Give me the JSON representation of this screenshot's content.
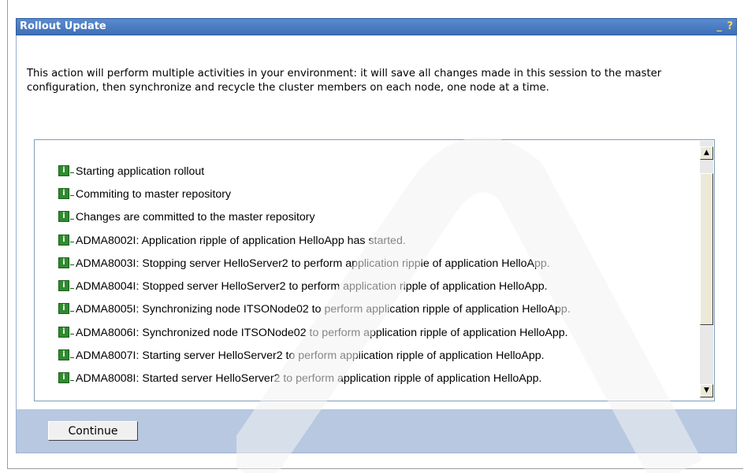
{
  "window": {
    "title": "Rollout Update",
    "controls": "_ ?"
  },
  "intro_text": "This action will perform multiple activities in your environment: it will save all changes made in this session to the master configuration, then synchronize and recycle the cluster members on each node, one node at a time.",
  "log": {
    "items": [
      "Starting application rollout",
      "Commiting to master repository",
      "Changes are committed to the master repository",
      "ADMA8002I: Application ripple of application HelloApp has started.",
      "ADMA8003I: Stopping server HelloServer2 to perform application ripple of application HelloApp.",
      "ADMA8004I: Stopped server HelloServer2 to perform application ripple of application HelloApp.",
      "ADMA8005I: Synchronizing node ITSONode02 to perform application ripple of application HelloApp.",
      "ADMA8006I: Synchronized node ITSONode02 to perform application ripple of application HelloApp.",
      "ADMA8007I: Starting server HelloServer2 to perform application ripple of application HelloApp.",
      "ADMA8008I: Started server HelloServer2 to perform application ripple of application HelloApp."
    ],
    "icon": "info-icon"
  },
  "buttons": {
    "continue": "Continue"
  },
  "colors": {
    "titlebar": "#3e6fb8",
    "footer": "#b7c8e0",
    "info_icon": "#2e8b2e"
  }
}
